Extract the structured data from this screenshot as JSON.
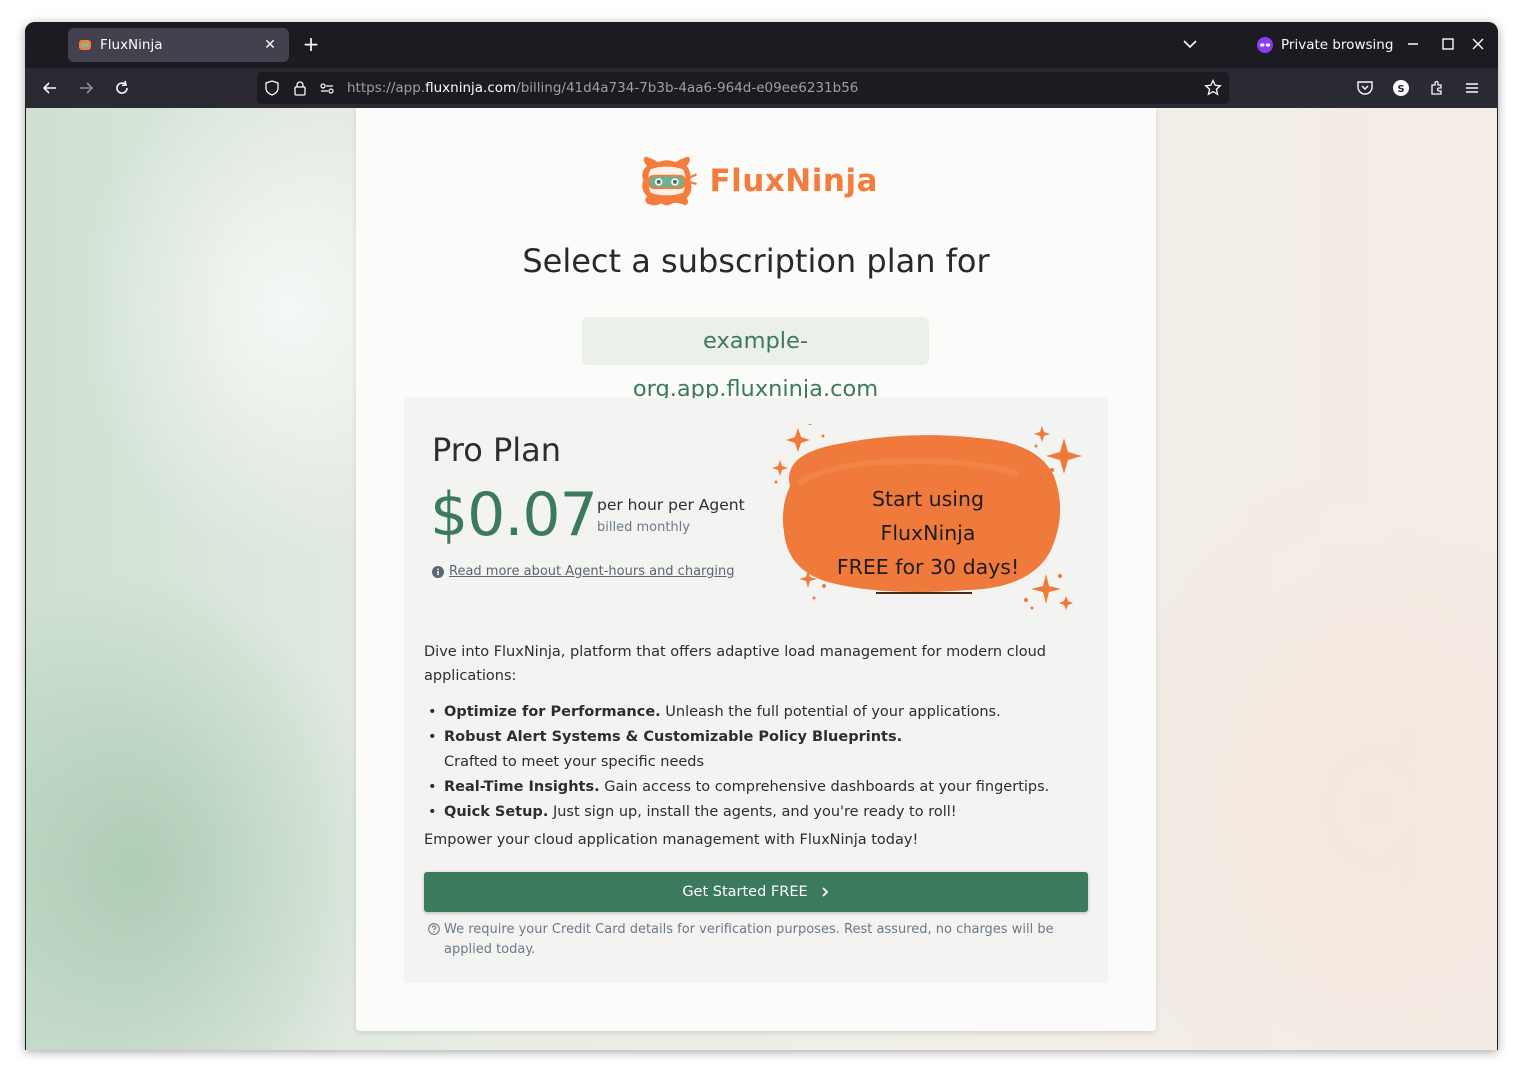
{
  "browser": {
    "tab_title": "FluxNinja",
    "private_label": "Private browsing",
    "url_prefix": "https://app.",
    "url_host": "fluxninja.com",
    "url_path": "/billing/41d4a734-7b3b-4aa6-964d-e09ee6231b56",
    "accent_private": "#8b3cf7"
  },
  "page": {
    "logo_text": "FluxNinja",
    "heading": "Select a subscription plan for",
    "org_domain": "example-org.app.fluxninja.com",
    "plan": {
      "name": "Pro Plan",
      "price": "$0.07",
      "unit": "per hour per Agent",
      "billing": "billed monthly",
      "read_more": "Read more about Agent-hours and charging"
    },
    "promo": {
      "line1": "Start using",
      "line2": "FluxNinja",
      "line3": "FREE for 30 days!"
    },
    "description": "Dive into FluxNinja, platform that offers adaptive load management for modern cloud applications:",
    "features": [
      {
        "title": "Optimize for Performance.",
        "text": "Unleash the full potential of your applications."
      },
      {
        "title": "Robust Alert Systems & Customizable Policy Blueprints.",
        "text": "Crafted to meet your specific needs"
      },
      {
        "title": "Real-Time Insights.",
        "text": "Gain access to comprehensive dashboards at your fingertips."
      },
      {
        "title": "Quick Setup.",
        "text": "Just sign up, install the agents, and you're ready to roll!"
      }
    ],
    "closing": "Empower your cloud application management with FluxNinja today!",
    "cta_label": "Get Started FREE",
    "note": "We require your Credit Card details for verification purposes. Rest assured, no charges will be applied today.",
    "colors": {
      "brand_orange": "#f27d3d",
      "brand_green": "#3b7a5c"
    }
  }
}
